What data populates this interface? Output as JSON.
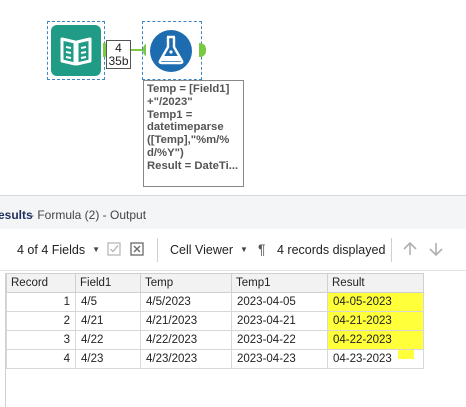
{
  "workflow": {
    "connection_label_line1": "4",
    "connection_label_line2": "35b",
    "formula_annotation": "Temp = [Field1]\n+\"/2023\"\nTemp1 =\ndatetimeparse\n([Temp],\"%m/%\nd/%Y\")\nResult = DateTi..."
  },
  "results": {
    "title": "esults",
    "subtitle": "- Formula (2) - Output"
  },
  "toolbar": {
    "fields_label": "4 of 4 Fields",
    "viewer_label": "Cell Viewer",
    "pilcrow": "¶",
    "records_label": "4 records displayed"
  },
  "grid": {
    "columns": [
      "Record",
      "Field1",
      "Temp",
      "Temp1",
      "Result"
    ],
    "rows": [
      {
        "record": "1",
        "field1": "4/5",
        "temp": "4/5/2023",
        "temp1": "2023-04-05",
        "result": "04-05-2023"
      },
      {
        "record": "2",
        "field1": "4/21",
        "temp": "4/21/2023",
        "temp1": "2023-04-21",
        "result": "04-21-2023"
      },
      {
        "record": "3",
        "field1": "4/22",
        "temp": "4/22/2023",
        "temp1": "2023-04-22",
        "result": "04-22-2023"
      },
      {
        "record": "4",
        "field1": "4/23",
        "temp": "4/23/2023",
        "temp1": "2023-04-23",
        "result": "04-23-2023"
      }
    ]
  },
  "colors": {
    "tool_green": "#1f9b86",
    "formula_blue": "#1e6cb0",
    "anchor_green": "#7ac943",
    "highlight_yellow": "#ffff3a"
  },
  "icons": [
    "book-icon",
    "formula-flask-icon",
    "checkbox-icon",
    "clear-icon",
    "pilcrow-icon",
    "arrow-up-icon",
    "arrow-down-icon"
  ]
}
